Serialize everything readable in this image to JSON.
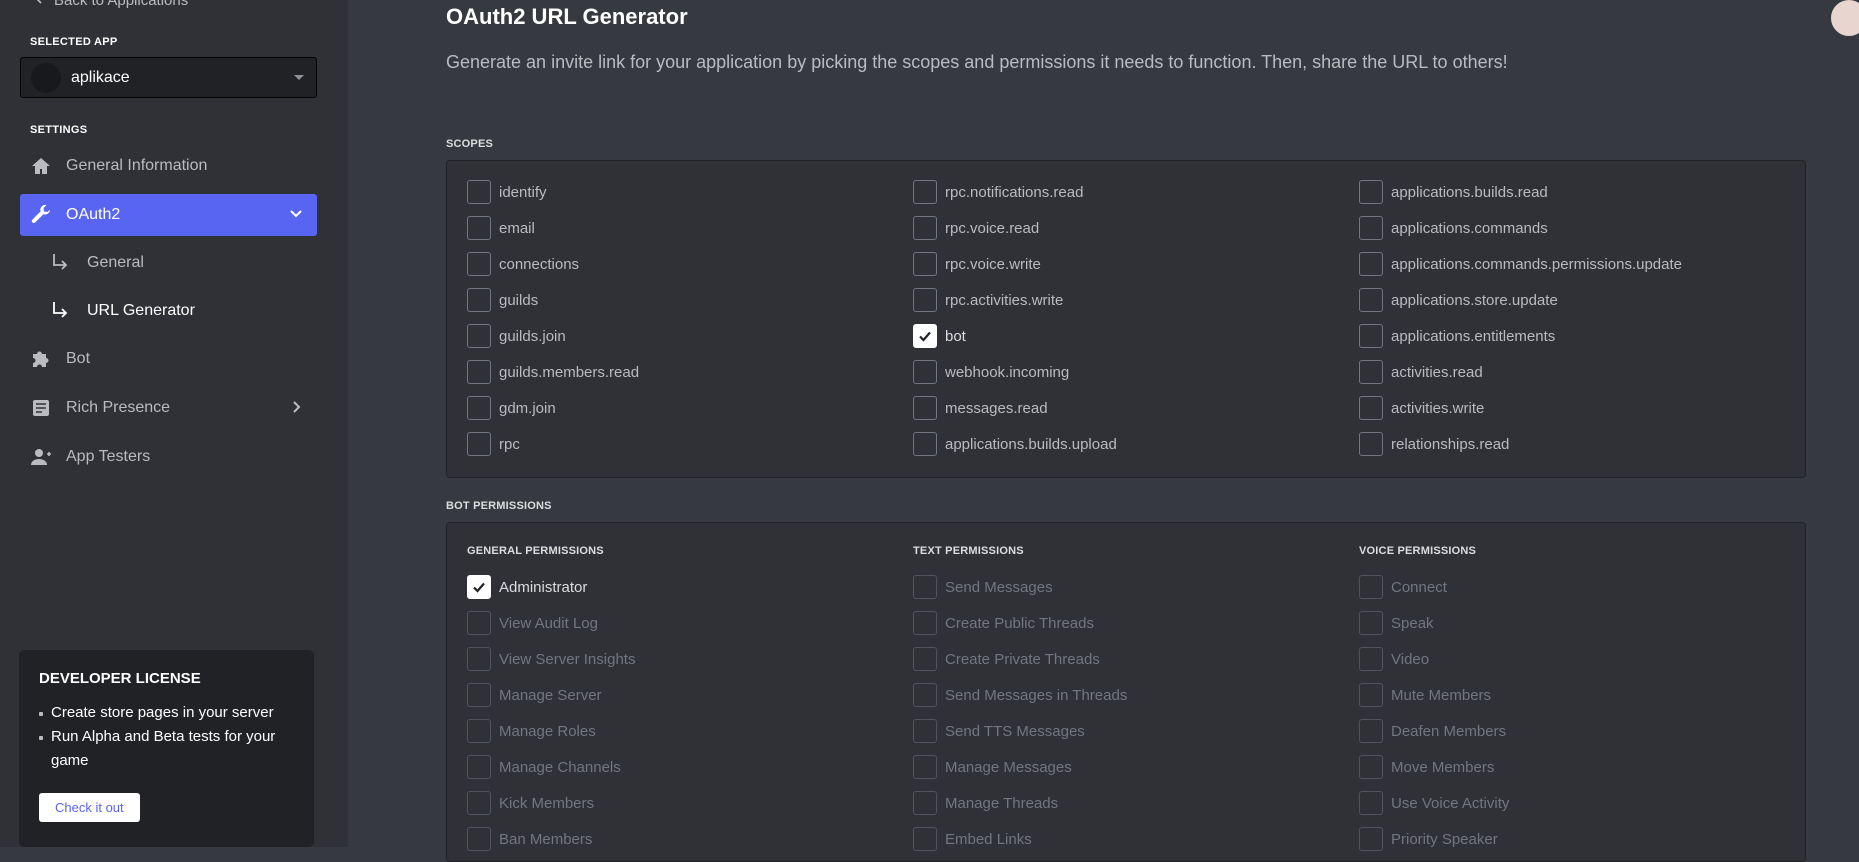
{
  "sidebar": {
    "back_label": "Back to Applications",
    "selected_app_label": "SELECTED APP",
    "app_name": "aplikace",
    "settings_label": "SETTINGS",
    "nav": {
      "general_info": "General Information",
      "oauth2": "OAuth2",
      "oauth2_general": "General",
      "oauth2_url_generator": "URL Generator",
      "bot": "Bot",
      "rich_presence": "Rich Presence",
      "app_testers": "App Testers"
    },
    "license": {
      "title": "DEVELOPER LICENSE",
      "items": [
        "Create store pages in your server",
        "Run Alpha and Beta tests for your game"
      ],
      "button": "Check it out"
    }
  },
  "main": {
    "title": "OAuth2 URL Generator",
    "description": "Generate an invite link for your application by picking the scopes and permissions it needs to function. Then, share the URL to others!",
    "scopes_label": "SCOPES",
    "scopes": [
      [
        {
          "label": "identify",
          "checked": false
        },
        {
          "label": "email",
          "checked": false
        },
        {
          "label": "connections",
          "checked": false
        },
        {
          "label": "guilds",
          "checked": false
        },
        {
          "label": "guilds.join",
          "checked": false
        },
        {
          "label": "guilds.members.read",
          "checked": false
        },
        {
          "label": "gdm.join",
          "checked": false
        },
        {
          "label": "rpc",
          "checked": false
        }
      ],
      [
        {
          "label": "rpc.notifications.read",
          "checked": false
        },
        {
          "label": "rpc.voice.read",
          "checked": false
        },
        {
          "label": "rpc.voice.write",
          "checked": false
        },
        {
          "label": "rpc.activities.write",
          "checked": false
        },
        {
          "label": "bot",
          "checked": true
        },
        {
          "label": "webhook.incoming",
          "checked": false
        },
        {
          "label": "messages.read",
          "checked": false
        },
        {
          "label": "applications.builds.upload",
          "checked": false
        }
      ],
      [
        {
          "label": "applications.builds.read",
          "checked": false
        },
        {
          "label": "applications.commands",
          "checked": false
        },
        {
          "label": "applications.commands.permissions.update",
          "checked": false
        },
        {
          "label": "applications.store.update",
          "checked": false
        },
        {
          "label": "applications.entitlements",
          "checked": false
        },
        {
          "label": "activities.read",
          "checked": false
        },
        {
          "label": "activities.write",
          "checked": false
        },
        {
          "label": "relationships.read",
          "checked": false
        }
      ]
    ],
    "bot_permissions_label": "BOT PERMISSIONS",
    "permission_groups": [
      {
        "heading": "GENERAL PERMISSIONS",
        "items": [
          {
            "label": "Administrator",
            "checked": true,
            "disabled": false
          },
          {
            "label": "View Audit Log",
            "checked": false,
            "disabled": true
          },
          {
            "label": "View Server Insights",
            "checked": false,
            "disabled": true
          },
          {
            "label": "Manage Server",
            "checked": false,
            "disabled": true
          },
          {
            "label": "Manage Roles",
            "checked": false,
            "disabled": true
          },
          {
            "label": "Manage Channels",
            "checked": false,
            "disabled": true
          },
          {
            "label": "Kick Members",
            "checked": false,
            "disabled": true
          },
          {
            "label": "Ban Members",
            "checked": false,
            "disabled": true
          }
        ]
      },
      {
        "heading": "TEXT PERMISSIONS",
        "items": [
          {
            "label": "Send Messages",
            "checked": false,
            "disabled": true
          },
          {
            "label": "Create Public Threads",
            "checked": false,
            "disabled": true
          },
          {
            "label": "Create Private Threads",
            "checked": false,
            "disabled": true
          },
          {
            "label": "Send Messages in Threads",
            "checked": false,
            "disabled": true
          },
          {
            "label": "Send TTS Messages",
            "checked": false,
            "disabled": true
          },
          {
            "label": "Manage Messages",
            "checked": false,
            "disabled": true
          },
          {
            "label": "Manage Threads",
            "checked": false,
            "disabled": true
          },
          {
            "label": "Embed Links",
            "checked": false,
            "disabled": true
          }
        ]
      },
      {
        "heading": "VOICE PERMISSIONS",
        "items": [
          {
            "label": "Connect",
            "checked": false,
            "disabled": true
          },
          {
            "label": "Speak",
            "checked": false,
            "disabled": true
          },
          {
            "label": "Video",
            "checked": false,
            "disabled": true
          },
          {
            "label": "Mute Members",
            "checked": false,
            "disabled": true
          },
          {
            "label": "Deafen Members",
            "checked": false,
            "disabled": true
          },
          {
            "label": "Move Members",
            "checked": false,
            "disabled": true
          },
          {
            "label": "Use Voice Activity",
            "checked": false,
            "disabled": true
          },
          {
            "label": "Priority Speaker",
            "checked": false,
            "disabled": true
          }
        ]
      }
    ]
  },
  "colors": {
    "accent": "#5865f2",
    "background": "#36393f",
    "sidebar": "#2f3136",
    "panel_border": "#202225"
  }
}
